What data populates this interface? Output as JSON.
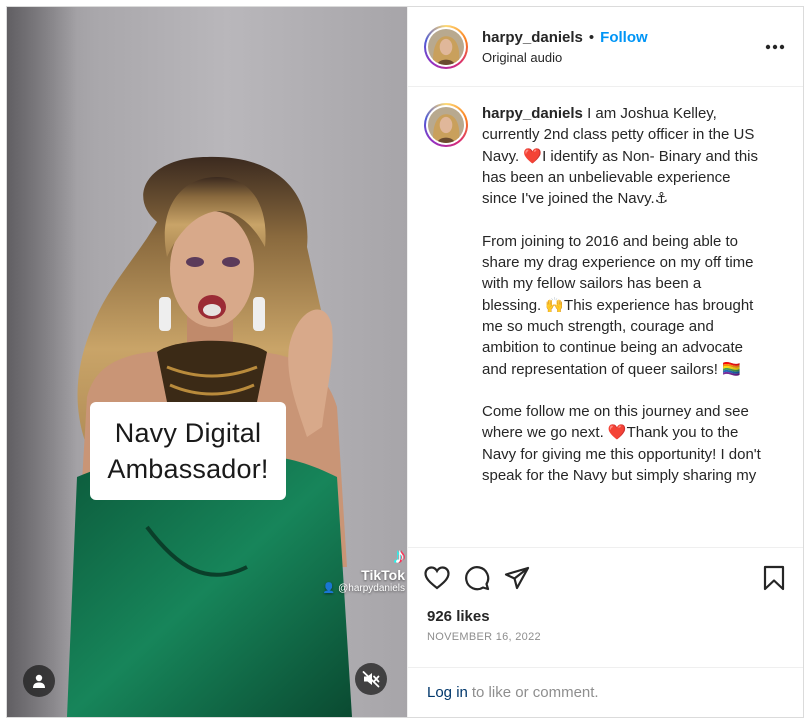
{
  "video": {
    "overlay_lines": [
      "Navy Digital",
      "Ambassador!"
    ],
    "watermark": {
      "logo": "♪",
      "brand": "TikTok",
      "handle": "@harpydaniels"
    },
    "user_tag_icon": "person-icon",
    "mute_icon": "speaker-muted-icon"
  },
  "header": {
    "username": "harpy_daniels",
    "separator": "•",
    "follow_label": "Follow",
    "subtitle": "Original audio",
    "more_icon": "ellipsis-icon"
  },
  "caption": {
    "username": "harpy_daniels",
    "paragraphs": [
      "I am Joshua Kelley, currently 2nd class petty officer in the US Navy. ❤️I identify as Non- Binary and this has been an unbelievable experience since I've joined the Navy.⚓",
      "From joining to 2016 and being able to share my drag experience on my off time with my fellow sailors has been a blessing. 🙌This experience has brought me so much strength, courage and ambition to continue being an advocate and representation of queer sailors! 🏳️‍🌈",
      "Come follow me on this journey and see where we go next. ❤️Thank you to the Navy for giving me this opportunity! I don't speak for the Navy but simply sharing my"
    ]
  },
  "actions": {
    "icons": [
      "heart-icon",
      "comment-icon",
      "share-icon",
      "bookmark-icon"
    ]
  },
  "likes": "926 likes",
  "date": "NOVEMBER 16, 2022",
  "login": {
    "link": "Log in",
    "rest": "to like or comment."
  },
  "colors": {
    "follow": "#0095f6",
    "link": "#00376b",
    "muted_text": "#8e8e8e",
    "dress": "#0f6b47"
  }
}
